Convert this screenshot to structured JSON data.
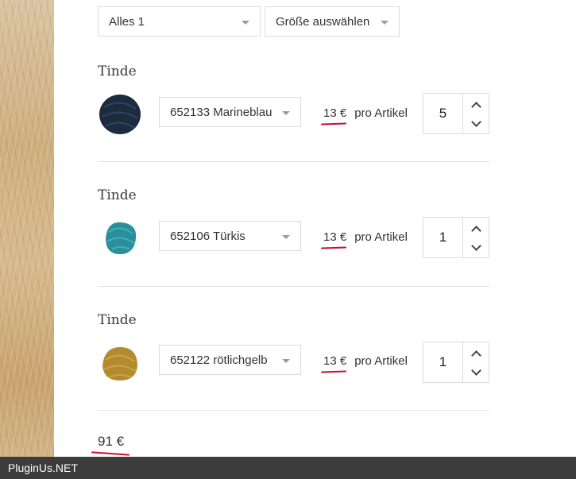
{
  "filters": {
    "category_value": "Alles 1",
    "size_value": "Größe auswählen"
  },
  "items": [
    {
      "title": "Tinde",
      "variant": "652133 Marineblau",
      "price": "13 €",
      "per": "pro Artikel",
      "quantity": "5",
      "yarn_color": "#1c2b3d"
    },
    {
      "title": "Tinde",
      "variant": "652106 Türkis",
      "price": "13 €",
      "per": "pro Artikel",
      "quantity": "1",
      "yarn_color": "#2a8f9a"
    },
    {
      "title": "Tinde",
      "variant": "652122 rötlichgelb",
      "price": "13 €",
      "per": "pro Artikel",
      "quantity": "1",
      "yarn_color": "#b38a2e"
    }
  ],
  "total": "91 €",
  "footer": {
    "brand": "PluginUs.NET"
  },
  "colors": {
    "underline": "#c8102e",
    "footer_bg": "#3c3c3c"
  }
}
